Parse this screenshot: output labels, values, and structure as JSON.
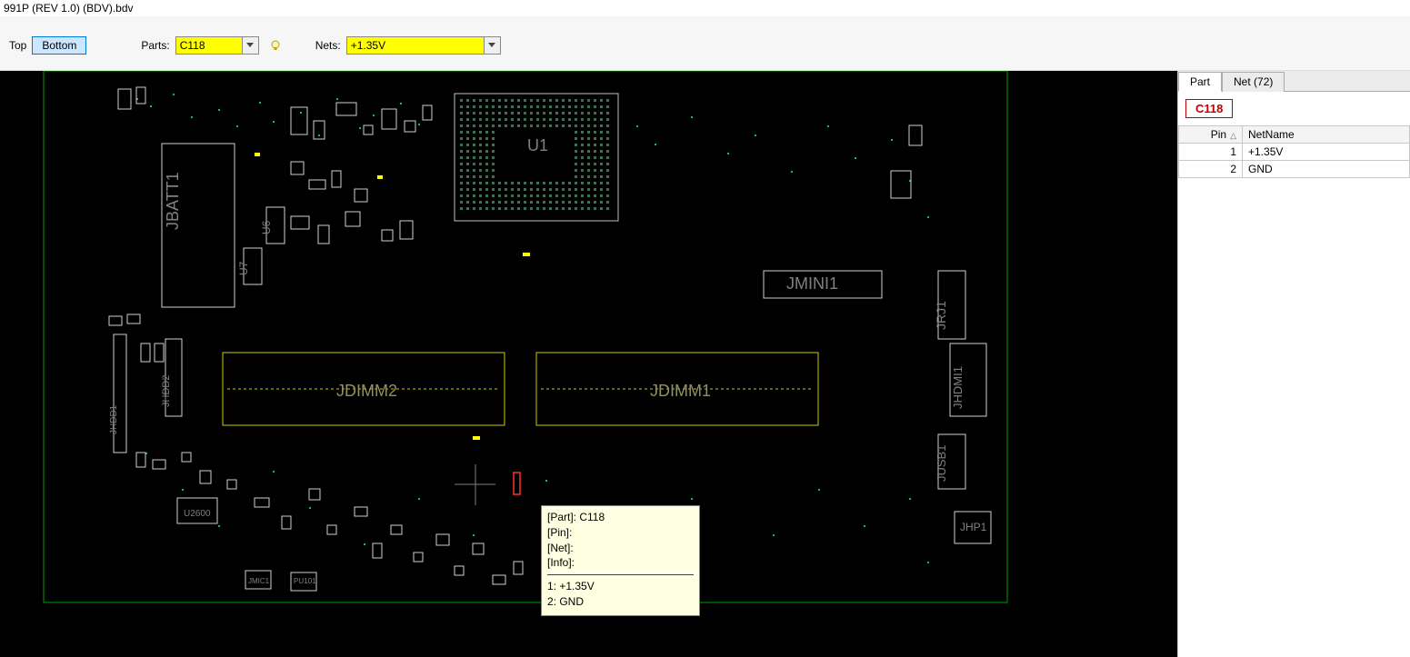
{
  "window": {
    "title_fragment": "991P (REV 1.0) (BDV).bdv"
  },
  "toolbar": {
    "top_label": "Top",
    "bottom_label": "Bottom",
    "parts_label": "Parts:",
    "parts_value": "C118",
    "nets_label": "Nets:",
    "nets_value": "+1.35V"
  },
  "pcb": {
    "labels": {
      "U1": "U1",
      "JBATT1": "JBATT1",
      "U6": "U6",
      "U7": "U7",
      "JMINI1": "JMINI1",
      "JRJ1": "JRJ1",
      "JHDMI1": "JHDMI1",
      "JUSB1": "JUSB1",
      "JHP1": "JHP1",
      "JDIMM1": "JDIMM1",
      "JDIMM2": "JDIMM2",
      "JHDD1": "JHDD1",
      "JHDD2": "JHDD2",
      "U2600": "U2600",
      "JMIC1": "JMIC1",
      "PU101": "PU101"
    }
  },
  "tooltip": {
    "part_label": "[Part]:",
    "part_value": "C118",
    "pin_label": "[Pin]:",
    "pin_value": "",
    "net_label": "[Net]:",
    "net_value": "",
    "info_label": "[Info]:",
    "info_value": "",
    "pin1": "1: +1.35V",
    "pin2": "2: GND"
  },
  "sidepanel": {
    "tab_part": "Part",
    "tab_net": "Net (72)",
    "selected_part": "C118",
    "columns": {
      "pin": "Pin",
      "netname": "NetName"
    },
    "rows": [
      {
        "pin": "1",
        "net": "+1.35V"
      },
      {
        "pin": "2",
        "net": "GND"
      }
    ]
  }
}
